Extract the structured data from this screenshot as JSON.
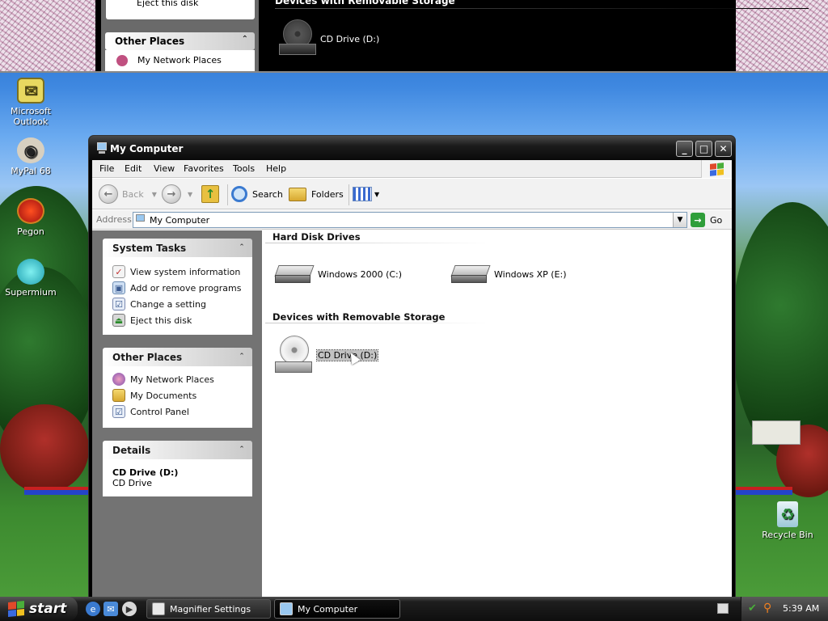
{
  "magnifier": {
    "eject_label": "Eject this disk",
    "other_places_label": "Other Places",
    "network_label": "My Network Places",
    "removable_header": "Devices with Removable Storage",
    "cd_label": "CD Drive (D:)"
  },
  "desktop_icons": [
    {
      "label": "Microsoft Outlook",
      "icon": "outlook-icon"
    },
    {
      "label": "MyPal 68",
      "icon": "mypal-icon"
    },
    {
      "label": "Pegon",
      "icon": "pegon-icon"
    },
    {
      "label": "Supermium",
      "icon": "supermium-icon"
    },
    {
      "label": "Recycle Bin",
      "icon": "recycle-bin-icon"
    }
  ],
  "window": {
    "title": "My Computer",
    "controls": {
      "minimize": "_",
      "maximize": "□",
      "close": "✕"
    }
  },
  "menubar": {
    "items": [
      "File",
      "Edit",
      "View",
      "Favorites",
      "Tools",
      "Help"
    ]
  },
  "toolbar": {
    "back_label": "Back",
    "search_label": "Search",
    "folders_label": "Folders"
  },
  "address": {
    "label": "Address",
    "value": "My Computer",
    "go_label": "Go"
  },
  "taskpane": {
    "system_tasks": {
      "title": "System Tasks",
      "items": [
        "View system information",
        "Add or remove programs",
        "Change a setting",
        "Eject this disk"
      ]
    },
    "other_places": {
      "title": "Other Places",
      "items": [
        "My Network Places",
        "My Documents",
        "Control Panel"
      ]
    },
    "details": {
      "title": "Details",
      "name": "CD Drive (D:)",
      "type": "CD Drive"
    }
  },
  "content": {
    "hard_disk_header": "Hard Disk Drives",
    "hard_disks": [
      "Windows 2000 (C:)",
      "Windows XP (E:)"
    ],
    "removable_header": "Devices with Removable Storage",
    "removable": [
      "CD Drive (D:)"
    ]
  },
  "taskbar": {
    "start_label": "start",
    "buttons": [
      "Magnifier Settings",
      "My Computer"
    ],
    "clock": "5:39 AM"
  },
  "colors": {
    "taskpane_bg": "#737373",
    "titlebar": "#1c1c1c",
    "go_green": "#2f9e3a"
  }
}
